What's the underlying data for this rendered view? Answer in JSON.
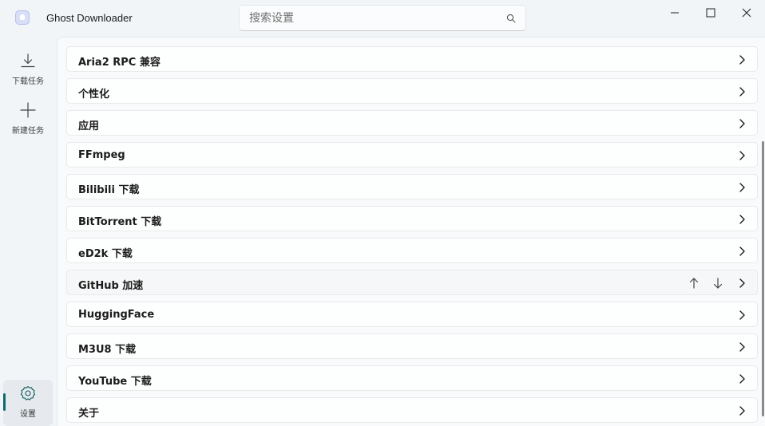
{
  "app": {
    "title": "Ghost Downloader"
  },
  "search": {
    "placeholder": "搜索设置"
  },
  "nav": {
    "items": [
      {
        "label": "下载任务",
        "icon": "download-icon"
      },
      {
        "label": "新建任务",
        "icon": "plus-icon"
      }
    ],
    "settings": {
      "label": "设置",
      "icon": "gear-icon",
      "active": true
    }
  },
  "settings_list": [
    {
      "label": "Aria2 RPC 兼容"
    },
    {
      "label": "个性化"
    },
    {
      "label": "应用"
    },
    {
      "label": "FFmpeg"
    },
    {
      "label": "Bilibili 下载"
    },
    {
      "label": "BitTorrent 下载"
    },
    {
      "label": "eD2k 下载"
    },
    {
      "label": "GitHub 加速",
      "reorder_controls": true
    },
    {
      "label": "HuggingFace"
    },
    {
      "label": "M3U8 下载"
    },
    {
      "label": "YouTube 下载"
    },
    {
      "label": "关于"
    }
  ],
  "colors": {
    "accent": "#0f6b6b",
    "background": "#f1f5f8",
    "card": "#fdfefe"
  }
}
